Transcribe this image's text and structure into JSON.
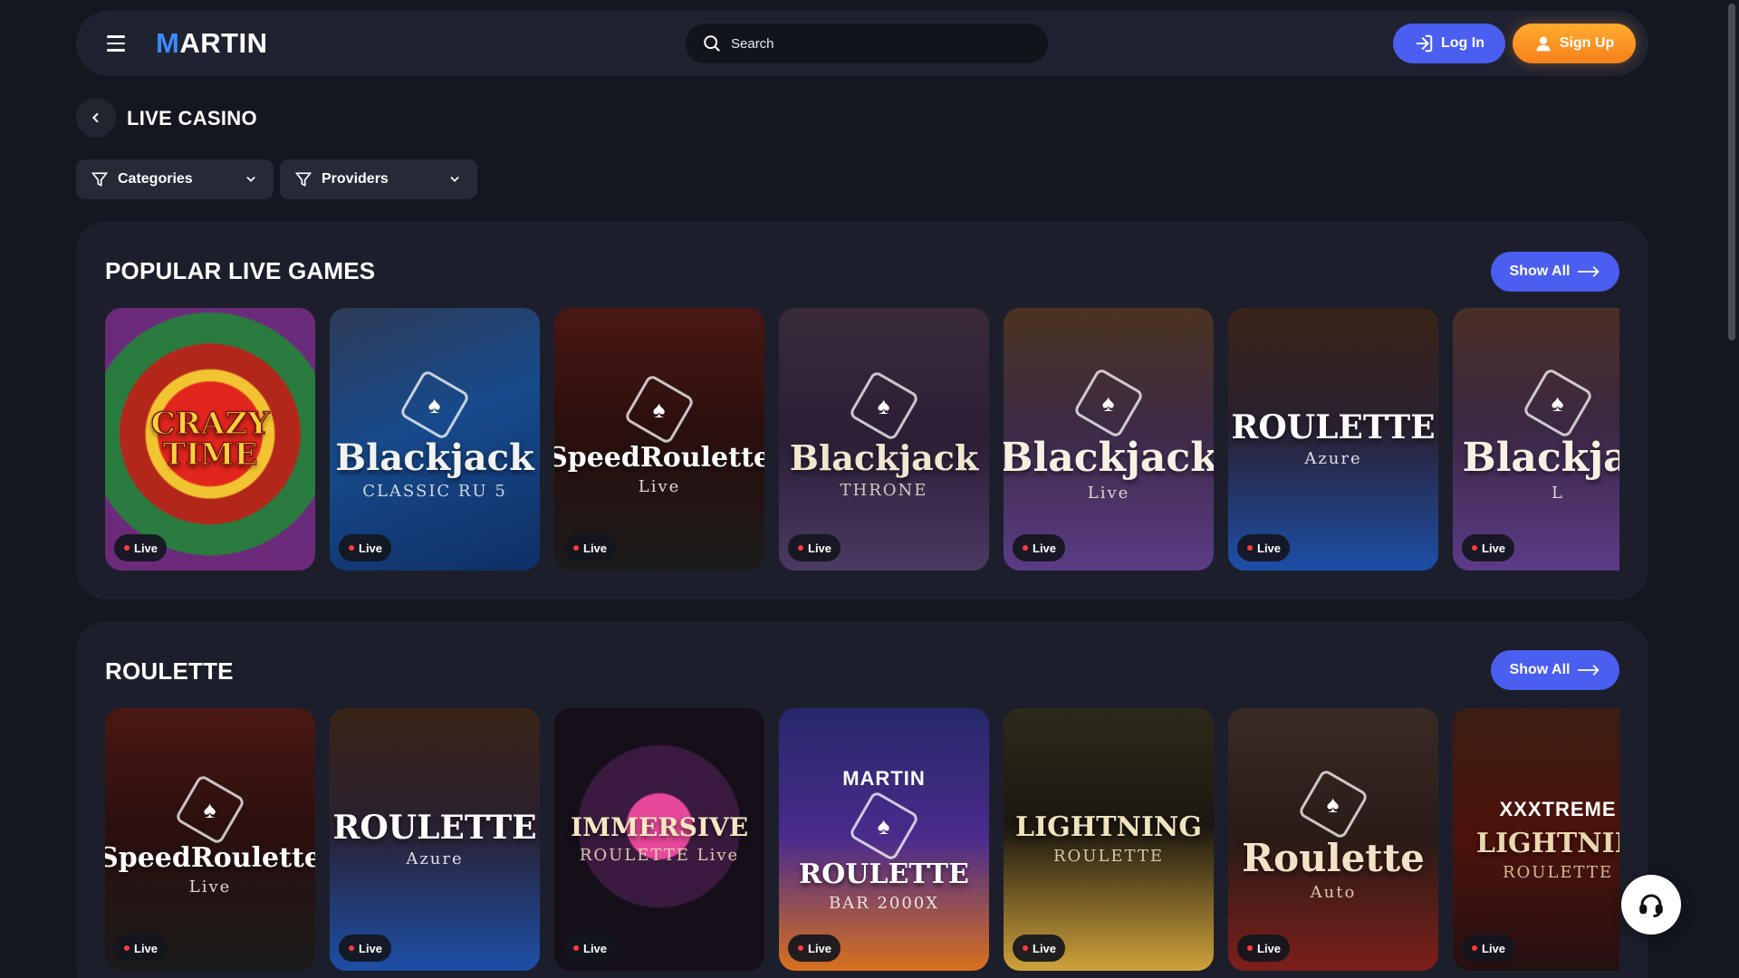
{
  "header": {
    "logo_prefix": "M",
    "logo_rest": "ARTIN",
    "search_placeholder": "Search",
    "login_label": "Log In",
    "signup_label": "Sign Up"
  },
  "page": {
    "title": "LIVE CASINO"
  },
  "filters": {
    "categories": "Categories",
    "providers": "Providers"
  },
  "sections": [
    {
      "title": "POPULAR LIVE GAMES",
      "show_all": "Show All",
      "games": [
        {
          "title": "CRAZY TIME",
          "sub": "",
          "badge": "Live",
          "theme": "crazy"
        },
        {
          "title": "Blackjack",
          "sub": "CLASSIC RU 5",
          "badge": "Live",
          "theme": "bj-classic"
        },
        {
          "title": "SpeedRoulette",
          "sub": "Live",
          "badge": "Live",
          "theme": "speed"
        },
        {
          "title": "Blackjack",
          "sub": "THRONE",
          "badge": "Live",
          "theme": "throne"
        },
        {
          "title": "Blackjack",
          "sub": "Live",
          "badge": "Live",
          "theme": "bj-purple"
        },
        {
          "title": "ROULETTE",
          "sub": "Azure",
          "badge": "Live",
          "theme": "azure"
        },
        {
          "title": "Blackjac",
          "sub": "L",
          "badge": "Live",
          "theme": "bj-purple2"
        }
      ]
    },
    {
      "title": "ROULETTE",
      "show_all": "Show All",
      "games": [
        {
          "title": "SpeedRoulette",
          "sub": "Live",
          "badge": "Live",
          "theme": "speed"
        },
        {
          "title": "ROULETTE",
          "sub": "Azure",
          "badge": "Live",
          "theme": "azure"
        },
        {
          "title": "IMMERSIVE",
          "sub": "ROULETTE Live",
          "badge": "Live",
          "theme": "immersive"
        },
        {
          "title": "ROULETTE",
          "sub": "BAR 2000X",
          "badge": "Live",
          "theme": "martin-bar",
          "brand": "MARTIN"
        },
        {
          "title": "LIGHTNING",
          "sub": "ROULETTE",
          "badge": "Live",
          "theme": "lightning"
        },
        {
          "title": "Roulette",
          "sub": "Auto",
          "badge": "Live",
          "theme": "auto"
        },
        {
          "title": "LIGHTNIN",
          "sub": "ROULETTE",
          "badge": "Live",
          "theme": "xxxtreme",
          "brand": "XXXTREME"
        }
      ]
    }
  ],
  "colors": {
    "background": "#151720",
    "panel": "#1c1f2b",
    "accent_blue": "#4a5ef0",
    "accent_orange": "#f7811b",
    "live_dot": "#ff3b3b"
  }
}
